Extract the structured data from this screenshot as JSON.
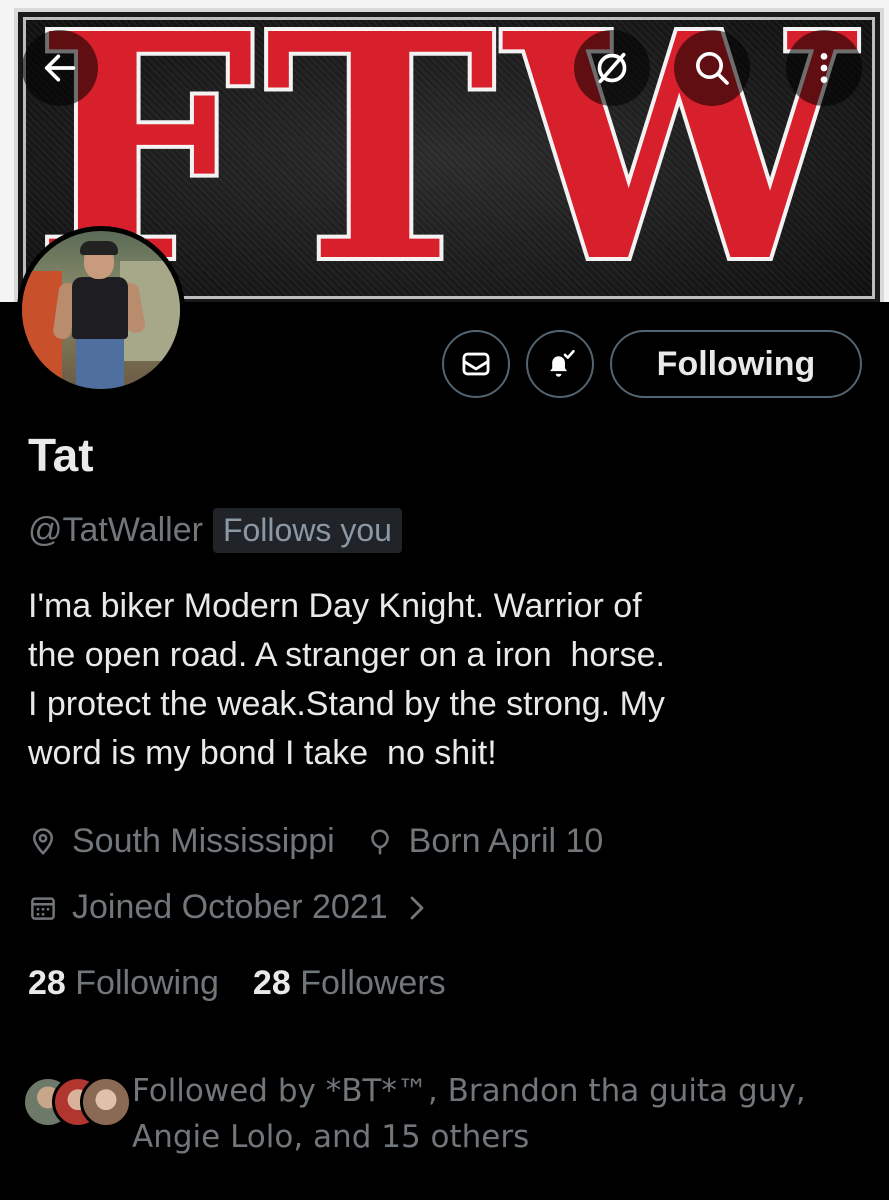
{
  "banner": {
    "text": "FTW"
  },
  "header": {
    "back_icon": "arrow-left-icon",
    "grok_icon": "slash-circle-icon",
    "search_icon": "search-icon",
    "more_icon": "more-vertical-icon"
  },
  "actions": {
    "message_icon": "envelope-icon",
    "notify_icon": "bell-check-icon",
    "follow_label": "Following"
  },
  "profile": {
    "name": "Tat",
    "handle": "@TatWaller",
    "follows_you": "Follows you",
    "bio": "I'ma biker Modern Day Knight. Warrior of\nthe open road. A stranger on a iron  horse.\nI protect the weak.Stand by the strong. My\nword is my bond I take  no shit!",
    "location": "South Mississippi",
    "birthday": "Born April 10",
    "joined": "Joined October 2021"
  },
  "stats": {
    "following_count": "28",
    "following_label": "Following",
    "followers_count": "28",
    "followers_label": "Followers"
  },
  "followed_by": {
    "text": "Followed by *BT*™, Brandon tha guita guy, Angie Lolo, and 15 others"
  },
  "colors": {
    "background": "#000000",
    "text_primary": "#e7e9ea",
    "text_secondary": "#71767b",
    "border": "#536471",
    "banner_red": "#d8202c"
  }
}
